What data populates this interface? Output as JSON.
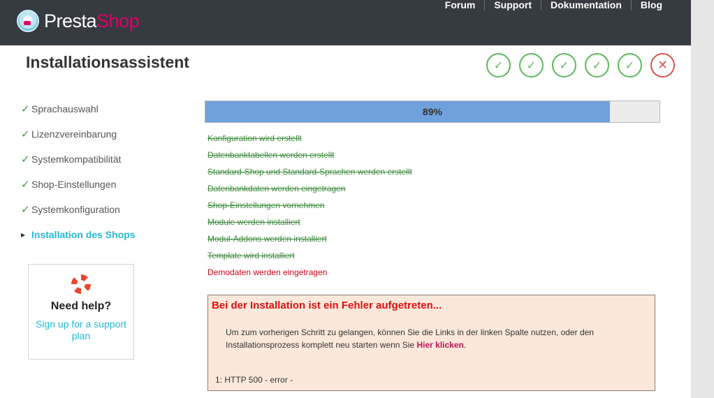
{
  "header": {
    "logo": {
      "part1": "Presta",
      "part2": "Shop"
    },
    "nav": [
      "Forum",
      "Support",
      "Dokumentation",
      "Blog"
    ]
  },
  "page_title": "Installationsassistent",
  "steps": [
    {
      "status": "done",
      "icon": "check-icon"
    },
    {
      "status": "done",
      "icon": "check-icon"
    },
    {
      "status": "done",
      "icon": "check-icon"
    },
    {
      "status": "done",
      "icon": "check-icon"
    },
    {
      "status": "done",
      "icon": "check-icon"
    },
    {
      "status": "error",
      "icon": "x-icon"
    }
  ],
  "sidebar": {
    "items": [
      {
        "label": "Sprachauswahl",
        "state": "done"
      },
      {
        "label": "Lizenzvereinbarung",
        "state": "done"
      },
      {
        "label": "Systemkompatibilität",
        "state": "done"
      },
      {
        "label": "Shop-Einstellungen",
        "state": "done"
      },
      {
        "label": "Systemkonfiguration",
        "state": "done"
      },
      {
        "label": "Installation des Shops",
        "state": "active"
      }
    ]
  },
  "help": {
    "title": "Need help?",
    "link": "Sign up for a support plan"
  },
  "progress": {
    "percent": 89,
    "label": "89%"
  },
  "tasks": [
    {
      "label": "Konfiguration wird erstellt",
      "state": "done"
    },
    {
      "label": "Datenbanktabellen werden erstellt",
      "state": "done"
    },
    {
      "label": "Standard-Shop und Standard-Sprachen werden erstellt",
      "state": "done"
    },
    {
      "label": "Datenbankdaten werden eingetragen",
      "state": "done"
    },
    {
      "label": "Shop-Einstellungen vornehmen",
      "state": "done"
    },
    {
      "label": "Module werden installiert",
      "state": "done"
    },
    {
      "label": "Modul-Addons werden installiert",
      "state": "done"
    },
    {
      "label": "Template wird installiert",
      "state": "done"
    },
    {
      "label": "Demodaten werden eingetragen",
      "state": "failed"
    }
  ],
  "error": {
    "title": "Bei der Installation ist ein Fehler aufgetreten...",
    "text_before": "Um zum vorherigen Schritt zu gelangen, können Sie die Links in der linken Spalte nutzen, oder den Installationsprozess komplett neu starten wenn Sie ",
    "link": "Hier klicken",
    "text_after": ".",
    "code": "1: HTTP 500 - error -"
  },
  "colors": {
    "header_bg": "#363a41",
    "brand_pink": "#df0067",
    "accent_blue": "#25b9d7",
    "success": "#5cb85c",
    "danger": "#d9534f",
    "progress_fill": "#6fa1dd"
  }
}
